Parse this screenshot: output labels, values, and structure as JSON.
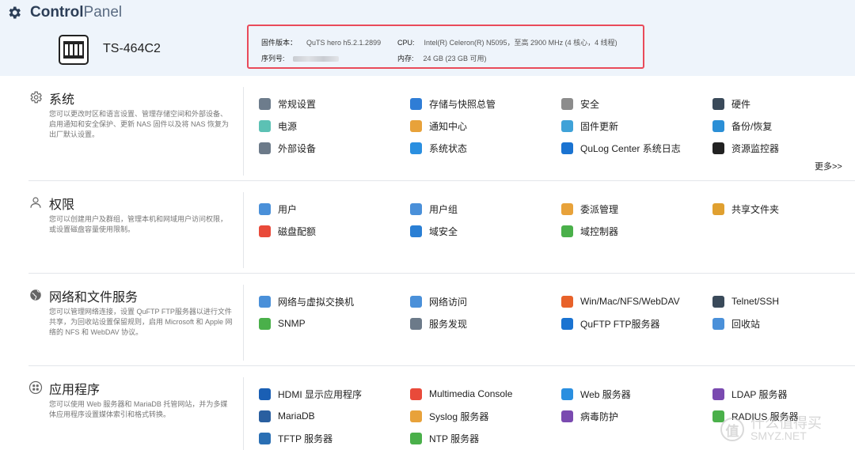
{
  "app": {
    "title_bold": "Control",
    "title_light": "Panel"
  },
  "device": {
    "model": "TS-464C2",
    "firmware_label": "固件版本：",
    "firmware_value": "QuTS hero h5.2.1.2899",
    "serial_label": "序列号:",
    "cpu_label": "CPU:",
    "cpu_value": "Intel(R) Celeron(R) N5095，至高 2900 MHz (4 核心，4 线程)",
    "memory_label": "内存:",
    "memory_value": "24 GB (23 GB 可用)"
  },
  "sections": [
    {
      "title": "系统",
      "icon": "gear-icon",
      "desc": "您可以更改时区和语言设置、管理存储空间和外部设备、启用通知和安全保护、更新 NAS 固件以及将 NAS 恢复为出厂默认设置。",
      "items": [
        "常规设置",
        "存储与快照总管",
        "安全",
        "硬件",
        "电源",
        "通知中心",
        "固件更新",
        "备份/恢复",
        "外部设备",
        "系统状态",
        "QuLog Center 系统日志",
        "资源监控器"
      ],
      "more": "更多>>"
    },
    {
      "title": "权限",
      "icon": "user-icon",
      "desc": "您可以创建用户及群组，管理本机和网域用户访问权限，或设置磁盘容量使用限制。",
      "items": [
        "用户",
        "用户组",
        "委派管理",
        "共享文件夹",
        "磁盘配额",
        "域安全",
        "域控制器"
      ]
    },
    {
      "title": "网络和文件服务",
      "icon": "globe-icon",
      "desc": "您可以管理网络连接，设置 QuFTP FTP服务器以进行文件共享，为回收站设置保留规则，启用 Microsoft 和 Apple 网络的 NFS 和 WebDAV 协议。",
      "items": [
        "网络与虚拟交换机",
        "网络访问",
        "Win/Mac/NFS/WebDAV",
        "Telnet/SSH",
        "SNMP",
        "服务发现",
        "QuFTP FTP服务器",
        "回收站"
      ]
    },
    {
      "title": "应用程序",
      "icon": "apps-icon",
      "desc": "您可以使用 Web 服务器和 MariaDB 托管网站，并为多媒体应用程序设置媒体索引和格式转换。",
      "items": [
        "HDMI 显示应用程序",
        "Multimedia Console",
        "Web 服务器",
        "LDAP 服务器",
        "MariaDB",
        "Syslog 服务器",
        "病毒防护",
        "RADIUS 服务器",
        "TFTP 服务器",
        "NTP 服务器"
      ]
    }
  ],
  "icon_colors": {
    "s0": [
      "#6d7c8c",
      "#2f7dd6",
      "#8c8c8c",
      "#3a4a5a",
      "#5cc1b4",
      "#e8a23a",
      "#3fa2d8",
      "#2b8fd6",
      "#6c7a89",
      "#2a8fe0",
      "#1a73d1",
      "#222222"
    ],
    "s1": [
      "#4a90d9",
      "#4a90d9",
      "#e8a23a",
      "#e0a030",
      "#e94a3a",
      "#2a7fd4",
      "#4ab04a"
    ],
    "s2": [
      "#4a90d9",
      "#4a90d9",
      "#e8622a",
      "#3a4a5a",
      "#4ab04a",
      "#6c7a89",
      "#1a73d1",
      "#4a90d9"
    ],
    "s3": [
      "#1a5fb4",
      "#e94a3a",
      "#2a8fe0",
      "#7a4ab0",
      "#2a5fa0",
      "#e8a23a",
      "#7a4ab0",
      "#4ab04a",
      "#2a6fb4",
      "#4ab04a"
    ]
  },
  "watermark": {
    "logo": "值",
    "line1": "什么值得买",
    "line2": "SMYZ.NET"
  }
}
